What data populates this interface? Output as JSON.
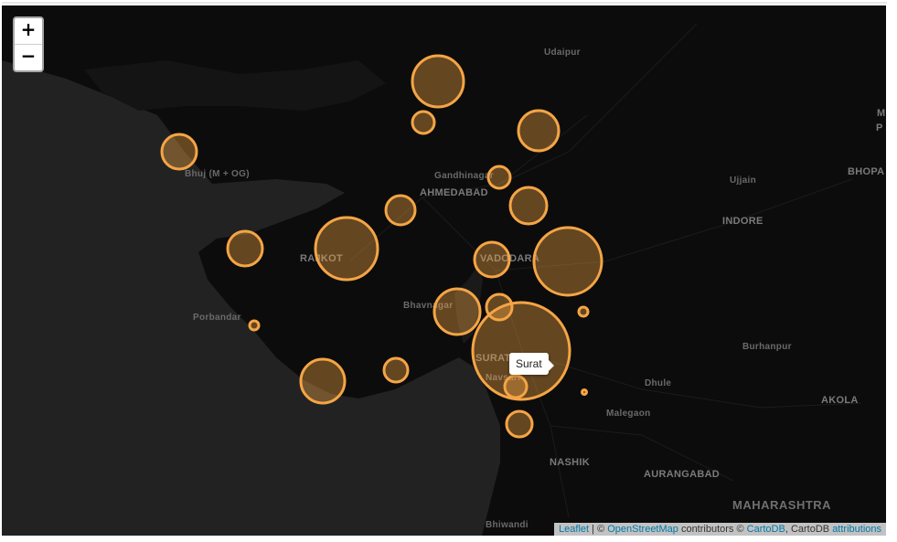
{
  "map": {
    "zoom_in_label": "+",
    "zoom_out_label": "−",
    "tooltip": "Surat",
    "marker_color": "#f5a545",
    "land_color": "#0d0d0d",
    "sea_color": "#222222",
    "place_labels": [
      "Udaipur",
      "Bhuj (M + OG)",
      "Gandhinagar",
      "AHMEDABAD",
      "Ujjain",
      "INDORE",
      "BHOPA",
      "RAJKOT",
      "VADODARA",
      "Bhavnagar",
      "Porbandar",
      "SURAT",
      "Navsari",
      "Burhanpur",
      "Dhule",
      "AKOLA",
      "Malegaon",
      "NASHIK",
      "AURANGABAD",
      "MAHARASHTRA",
      "Bhiwandi",
      "M",
      "P"
    ],
    "attribution": {
      "leaflet": "Leaflet",
      "sep1": " | © ",
      "osm": "OpenStreetMap",
      "contributors": " contributors © ",
      "cartodb": "CartoDB",
      "sep2": ", CartoDB ",
      "attributions": "attributions"
    }
  }
}
